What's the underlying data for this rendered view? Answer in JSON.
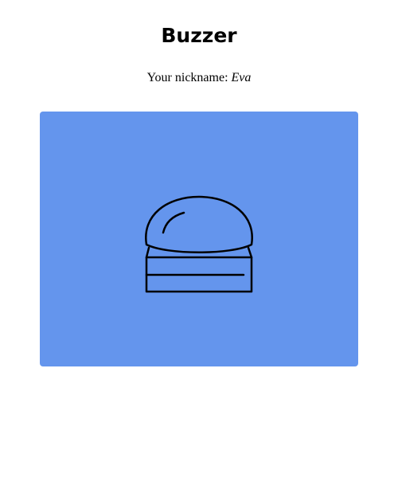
{
  "header": {
    "title": "Buzzer"
  },
  "nickname": {
    "prefix": "Your nickname: ",
    "value": "Eva"
  },
  "buzzer": {
    "icon": "buzzer-icon",
    "color": "#6495ED",
    "icon_color": "#000000"
  }
}
